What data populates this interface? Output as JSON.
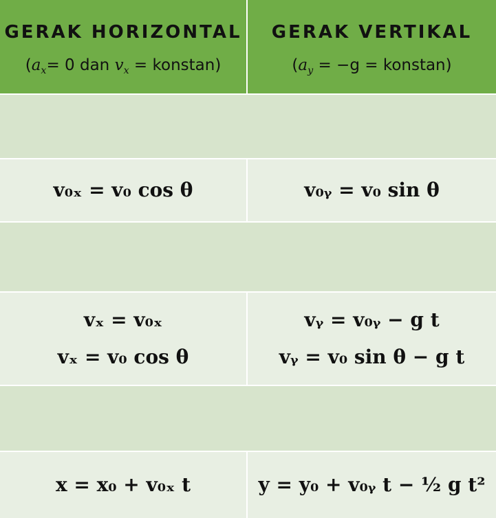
{
  "header": {
    "horizontal_title": "GERAK HORIZONTAL",
    "vertical_title": "GERAK VERTIKAL",
    "horizontal_condition": {
      "open": "(",
      "ax": "a",
      "ax_sub": "x",
      "eq0": "= 0 dan ",
      "vx": "v",
      "vx_sub": "x",
      "eqk": " = konstan)"
    },
    "vertical_condition": {
      "open": "(",
      "ay": "a",
      "ay_sub": "y",
      "eq": " = −g = konstan)"
    }
  },
  "rows": {
    "initial_velocity": {
      "horizontal": "v₀ₓ = v₀ cos θ",
      "vertical": "v₀ᵧ = v₀ sin θ"
    },
    "velocity": {
      "horizontal_1": "vₓ = v₀ₓ",
      "horizontal_2": "vₓ = v₀ cos θ",
      "vertical_1": "vᵧ = v₀ᵧ − g t",
      "vertical_2": "vᵧ = v₀ sin θ − g t"
    },
    "position": {
      "horizontal": "x = x₀ + v₀ₓ t",
      "vertical": "y = y₀ + v₀ᵧ t − ½ g t²"
    }
  },
  "colors": {
    "header_green": "#70ad47",
    "band_green": "#d7e4cc",
    "row_green": "#e8efe3"
  }
}
